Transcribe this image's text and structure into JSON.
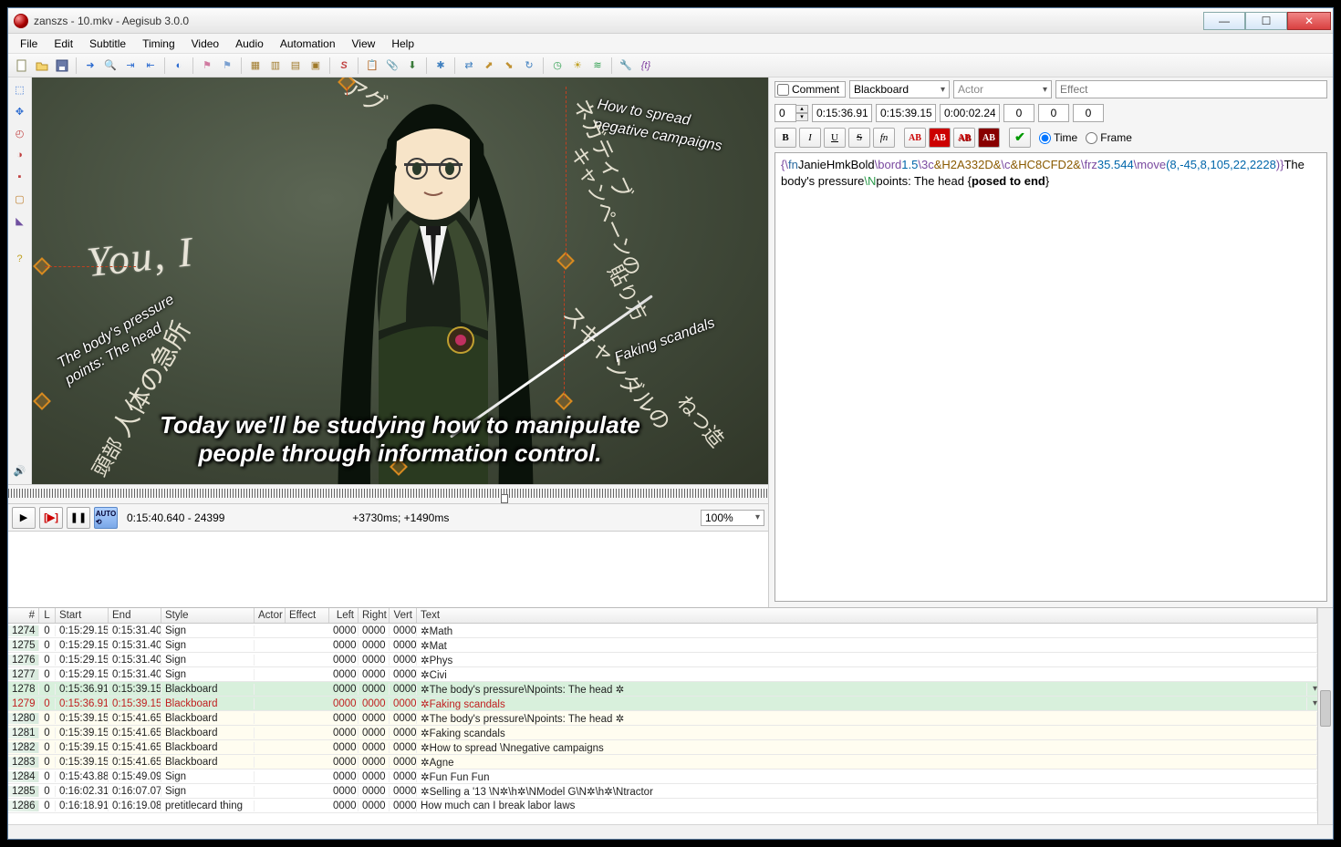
{
  "window": {
    "title": "zanszs - 10.mkv - Aegisub 3.0.0"
  },
  "menu": [
    "File",
    "Edit",
    "Subtitle",
    "Timing",
    "Video",
    "Audio",
    "Automation",
    "View",
    "Help"
  ],
  "video": {
    "time_label": "0:15:40.640 - 24399",
    "offset_label": "+3730ms; +1490ms",
    "zoom": "100%",
    "subtitle_line1": "Today we'll be studying how to manipulate",
    "subtitle_line2": "people through information control.",
    "chalk_big": "You, I",
    "chalk_topright1": "How to spread",
    "chalk_topright2": "negative campaigns",
    "chalk_midright": "Faking scandals",
    "chalk_left1": "The body's pressure",
    "chalk_left2": "points: The head"
  },
  "edit": {
    "comment_label": "Comment",
    "style": "Blackboard",
    "actor_placeholder": "Actor",
    "effect_placeholder": "Effect",
    "layer": "0",
    "start": "0:15:36.91",
    "end": "0:15:39.15",
    "dur": "0:00:02.24",
    "marginL": "0",
    "marginR": "0",
    "marginV": "0",
    "radio_time": "Time",
    "radio_frame": "Frame",
    "text_parts": {
      "p1": "{\\",
      "p2": "fn",
      "p3": "JanieHmkBold",
      "p4": "\\bord",
      "p5": "1.5",
      "p6": "\\3c",
      "p7": "&H2A332D&",
      "p8": "\\c",
      "p9": "&HC8CFD2&",
      "p10": "\\frz",
      "p11": "35.544",
      "p12": "\\move",
      "p13": "(8,-45,8,105,22,",
      "p14": "2228",
      "p15": ")}",
      "p16": "The body's pressure",
      "p17": "\\N",
      "p18": "points: The head {",
      "p19": "posed to end",
      "p20": "}"
    }
  },
  "grid": {
    "headers": [
      "#",
      "L",
      "Start",
      "End",
      "Style",
      "Actor",
      "Effect",
      "Left",
      "Right",
      "Vert",
      "Text"
    ],
    "rows": [
      {
        "idx": "1274",
        "l": "0",
        "start": "0:15:29.15",
        "end": "0:15:31.40",
        "style": "Sign",
        "left": "0000",
        "right": "0000",
        "vert": "0000",
        "text": "✲Math",
        "sel": false,
        "alt": false,
        "red": false
      },
      {
        "idx": "1275",
        "l": "0",
        "start": "0:15:29.15",
        "end": "0:15:31.40",
        "style": "Sign",
        "left": "0000",
        "right": "0000",
        "vert": "0000",
        "text": "✲Mat",
        "sel": false,
        "alt": false,
        "red": false
      },
      {
        "idx": "1276",
        "l": "0",
        "start": "0:15:29.15",
        "end": "0:15:31.40",
        "style": "Sign",
        "left": "0000",
        "right": "0000",
        "vert": "0000",
        "text": "✲Phys",
        "sel": false,
        "alt": false,
        "red": false
      },
      {
        "idx": "1277",
        "l": "0",
        "start": "0:15:29.15",
        "end": "0:15:31.40",
        "style": "Sign",
        "left": "0000",
        "right": "0000",
        "vert": "0000",
        "text": "✲Civi",
        "sel": false,
        "alt": false,
        "red": false
      },
      {
        "idx": "1278",
        "l": "0",
        "start": "0:15:36.91",
        "end": "0:15:39.15",
        "style": "Blackboard",
        "left": "0000",
        "right": "0000",
        "vert": "0000",
        "text": "✲The body's pressure\\Npoints: The head ✲",
        "sel": true,
        "alt": false,
        "red": false
      },
      {
        "idx": "1279",
        "l": "0",
        "start": "0:15:36.91",
        "end": "0:15:39.15",
        "style": "Blackboard",
        "left": "0000",
        "right": "0000",
        "vert": "0000",
        "text": "✲Faking scandals",
        "sel": true,
        "alt": false,
        "red": true
      },
      {
        "idx": "1280",
        "l": "0",
        "start": "0:15:39.15",
        "end": "0:15:41.65",
        "style": "Blackboard",
        "left": "0000",
        "right": "0000",
        "vert": "0000",
        "text": "✲The body's pressure\\Npoints: The head ✲",
        "sel": false,
        "alt": true,
        "red": false
      },
      {
        "idx": "1281",
        "l": "0",
        "start": "0:15:39.15",
        "end": "0:15:41.65",
        "style": "Blackboard",
        "left": "0000",
        "right": "0000",
        "vert": "0000",
        "text": "✲Faking scandals",
        "sel": false,
        "alt": true,
        "red": false
      },
      {
        "idx": "1282",
        "l": "0",
        "start": "0:15:39.15",
        "end": "0:15:41.65",
        "style": "Blackboard",
        "left": "0000",
        "right": "0000",
        "vert": "0000",
        "text": "✲How to spread \\Nnegative campaigns",
        "sel": false,
        "alt": true,
        "red": false
      },
      {
        "idx": "1283",
        "l": "0",
        "start": "0:15:39.15",
        "end": "0:15:41.65",
        "style": "Blackboard",
        "left": "0000",
        "right": "0000",
        "vert": "0000",
        "text": "✲Agne",
        "sel": false,
        "alt": true,
        "red": false
      },
      {
        "idx": "1284",
        "l": "0",
        "start": "0:15:43.88",
        "end": "0:15:49.09",
        "style": "Sign",
        "left": "0000",
        "right": "0000",
        "vert": "0000",
        "text": "✲Fun Fun Fun",
        "sel": false,
        "alt": false,
        "red": false
      },
      {
        "idx": "1285",
        "l": "0",
        "start": "0:16:02.31",
        "end": "0:16:07.07",
        "style": "Sign",
        "left": "0000",
        "right": "0000",
        "vert": "0000",
        "text": "✲Selling a '13 \\N✲\\h✲\\NModel G\\N✲\\h✲\\Ntractor",
        "sel": false,
        "alt": false,
        "red": false
      },
      {
        "idx": "1286",
        "l": "0",
        "start": "0:16:18.91",
        "end": "0:16:19.08",
        "style": "pretitlecard thing",
        "left": "0000",
        "right": "0000",
        "vert": "0000",
        "text": "How much can I break labor laws",
        "sel": false,
        "alt": false,
        "red": false
      }
    ]
  }
}
